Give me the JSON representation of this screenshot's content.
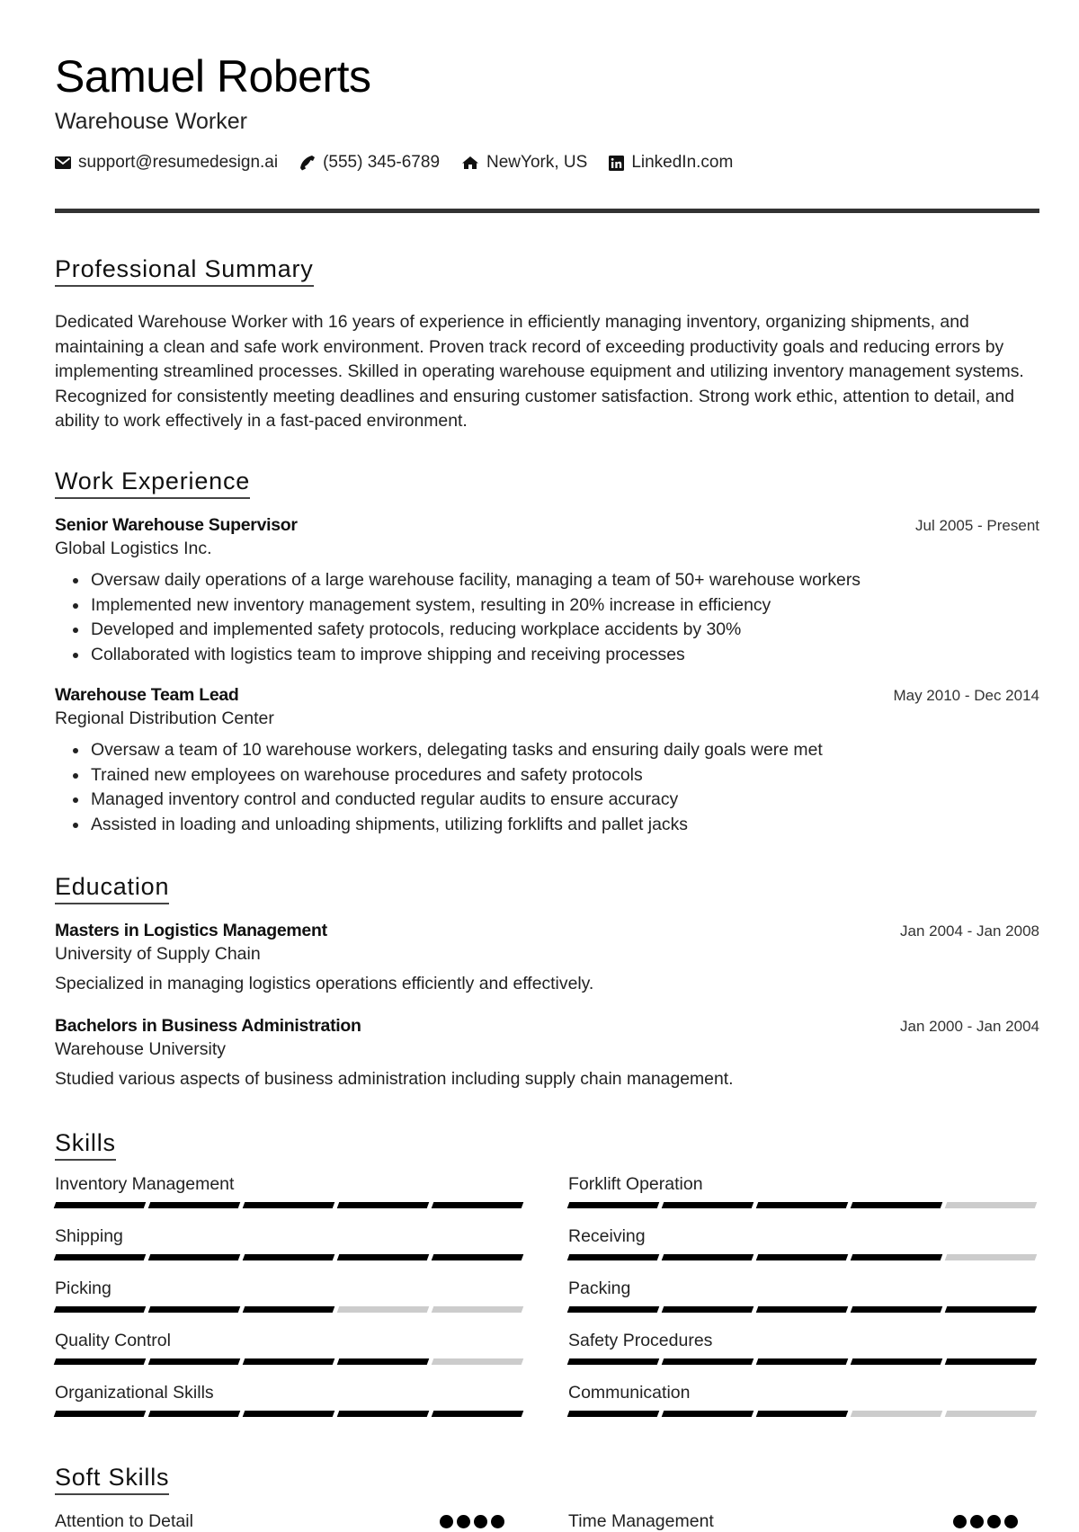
{
  "header": {
    "name": "Samuel Roberts",
    "title": "Warehouse Worker",
    "contacts": [
      {
        "icon": "envelope-icon",
        "text": "support@resumedesign.ai"
      },
      {
        "icon": "phone-icon",
        "text": "(555) 345-6789"
      },
      {
        "icon": "home-icon",
        "text": "NewYork, US"
      },
      {
        "icon": "linkedin-icon",
        "text": "LinkedIn.com"
      }
    ]
  },
  "summary": {
    "heading": "Professional Summary",
    "text": "Dedicated Warehouse Worker with 16 years of experience in efficiently managing inventory, organizing shipments, and maintaining a clean and safe work environment. Proven track record of exceeding productivity goals and reducing errors by implementing streamlined processes. Skilled in operating warehouse equipment and utilizing inventory management systems. Recognized for consistently meeting deadlines and ensuring customer satisfaction. Strong work ethic, attention to detail, and ability to work effectively in a fast-paced environment."
  },
  "experience": {
    "heading": "Work Experience",
    "jobs": [
      {
        "title": "Senior Warehouse Supervisor",
        "company": "Global Logistics Inc.",
        "dates": "Jul 2005 - Present",
        "bullets": [
          "Oversaw daily operations of a large warehouse facility, managing a team of 50+ warehouse workers",
          "Implemented new inventory management system, resulting in 20% increase in efficiency",
          "Developed and implemented safety protocols, reducing workplace accidents by 30%",
          "Collaborated with logistics team to improve shipping and receiving processes"
        ]
      },
      {
        "title": "Warehouse Team Lead",
        "company": "Regional Distribution Center",
        "dates": "May 2010 - Dec 2014",
        "bullets": [
          "Oversaw a team of 10 warehouse workers, delegating tasks and ensuring daily goals were met",
          "Trained new employees on warehouse procedures and safety protocols",
          "Managed inventory control and conducted regular audits to ensure accuracy",
          "Assisted in loading and unloading shipments, utilizing forklifts and pallet jacks"
        ]
      }
    ]
  },
  "education": {
    "heading": "Education",
    "items": [
      {
        "degree": "Masters in Logistics Management",
        "school": "University of Supply Chain",
        "dates": "Jan 2004 - Jan 2008",
        "description": "Specialized in managing logistics operations efficiently and effectively."
      },
      {
        "degree": "Bachelors in Business Administration",
        "school": "Warehouse University",
        "dates": "Jan 2000 - Jan 2004",
        "description": "Studied various aspects of business administration including supply chain management."
      }
    ]
  },
  "skills": {
    "heading": "Skills",
    "max_level": 5,
    "items": [
      {
        "name": "Inventory Management",
        "level": 5
      },
      {
        "name": "Forklift Operation",
        "level": 4
      },
      {
        "name": "Shipping",
        "level": 5
      },
      {
        "name": "Receiving",
        "level": 4
      },
      {
        "name": "Picking",
        "level": 3
      },
      {
        "name": "Packing",
        "level": 5
      },
      {
        "name": "Quality Control",
        "level": 4
      },
      {
        "name": "Safety Procedures",
        "level": 5
      },
      {
        "name": "Organizational Skills",
        "level": 5
      },
      {
        "name": "Communication",
        "level": 3
      }
    ]
  },
  "soft_skills": {
    "heading": "Soft Skills",
    "items": [
      {
        "name": "Attention to Detail",
        "dots": 4
      },
      {
        "name": "Time Management",
        "dots": 4
      }
    ]
  }
}
